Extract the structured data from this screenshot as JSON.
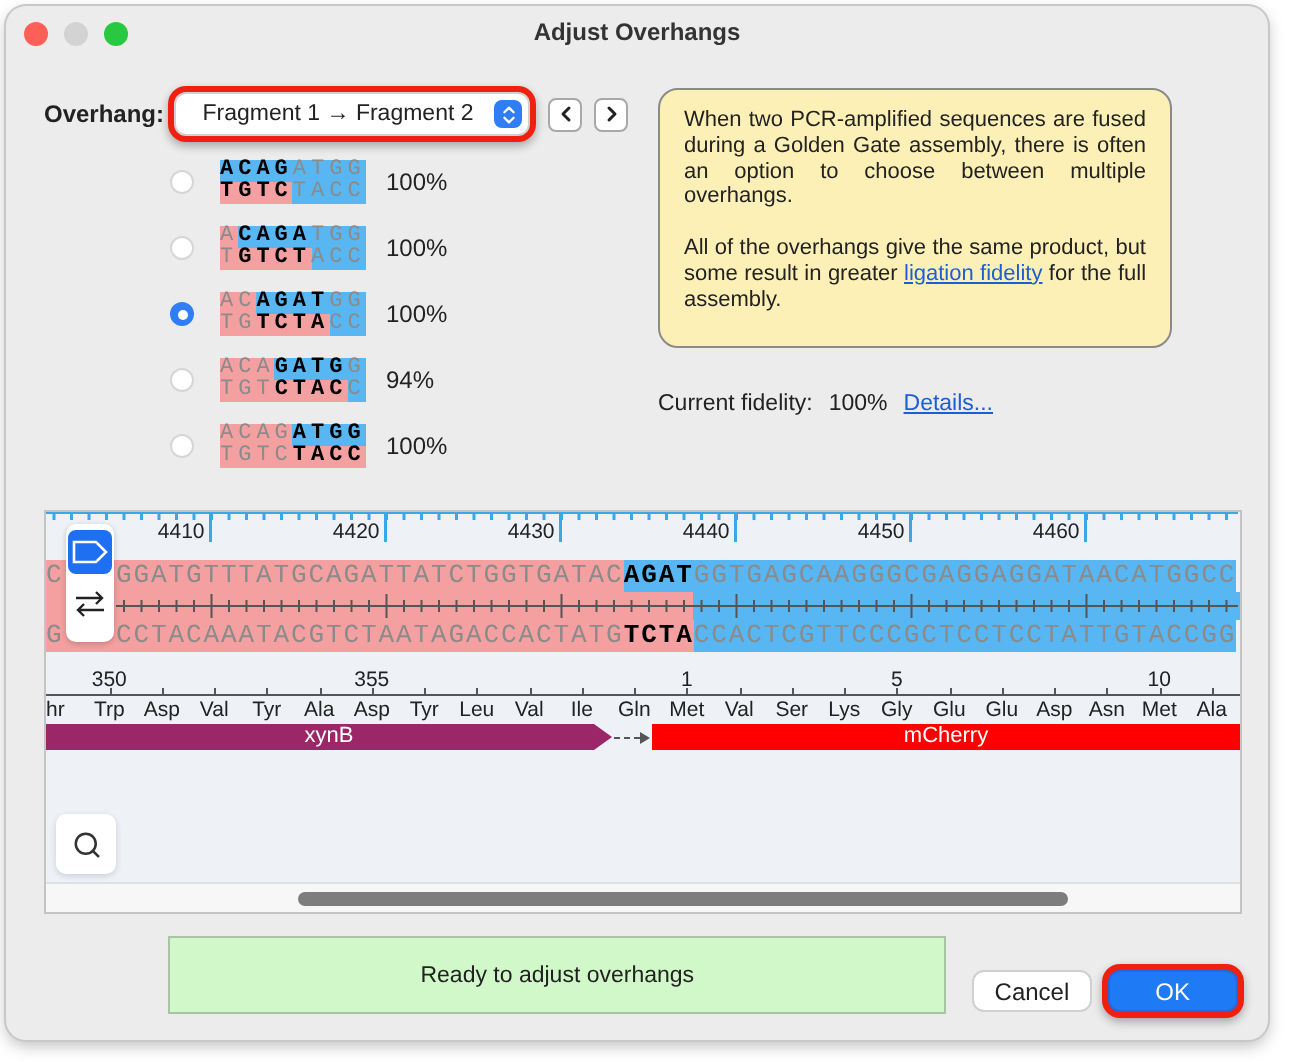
{
  "window": {
    "title": "Adjust Overhangs"
  },
  "overhang": {
    "label": "Overhang:",
    "value": "Fragment 1 → Fragment 2",
    "highlighted": true
  },
  "options": [
    {
      "selected": false,
      "fidelity": "100%",
      "top": [
        {
          "text": "ACAG",
          "bold": true,
          "color": "#58b6f2"
        },
        {
          "text": "ATGG",
          "bold": false,
          "color": "#58b6f2"
        }
      ],
      "bottom": [
        {
          "text": "TGTC",
          "bold": true,
          "color": "#f5a0a0"
        },
        {
          "text": "TACC",
          "bold": false,
          "color": "#58b6f2"
        }
      ]
    },
    {
      "selected": false,
      "fidelity": "100%",
      "top": [
        {
          "text": "A",
          "bold": false,
          "color": "#f5a0a0"
        },
        {
          "text": "CAGA",
          "bold": true,
          "color": "#58b6f2"
        },
        {
          "text": "TGG",
          "bold": false,
          "color": "#58b6f2"
        }
      ],
      "bottom": [
        {
          "text": "T",
          "bold": false,
          "color": "#f5a0a0"
        },
        {
          "text": "GTCT",
          "bold": true,
          "color": "#f5a0a0"
        },
        {
          "text": "ACC",
          "bold": false,
          "color": "#58b6f2"
        }
      ]
    },
    {
      "selected": true,
      "fidelity": "100%",
      "top": [
        {
          "text": "AC",
          "bold": false,
          "color": "#f5a0a0"
        },
        {
          "text": "AGAT",
          "bold": true,
          "color": "#58b6f2"
        },
        {
          "text": "GG",
          "bold": false,
          "color": "#58b6f2"
        }
      ],
      "bottom": [
        {
          "text": "TG",
          "bold": false,
          "color": "#f5a0a0"
        },
        {
          "text": "TCTA",
          "bold": true,
          "color": "#f5a0a0"
        },
        {
          "text": "CC",
          "bold": false,
          "color": "#58b6f2"
        }
      ]
    },
    {
      "selected": false,
      "fidelity": "94%",
      "top": [
        {
          "text": "ACA",
          "bold": false,
          "color": "#f5a0a0"
        },
        {
          "text": "GATG",
          "bold": true,
          "color": "#58b6f2"
        },
        {
          "text": "G",
          "bold": false,
          "color": "#58b6f2"
        }
      ],
      "bottom": [
        {
          "text": "TGT",
          "bold": false,
          "color": "#f5a0a0"
        },
        {
          "text": "CTAC",
          "bold": true,
          "color": "#f5a0a0"
        },
        {
          "text": "C",
          "bold": false,
          "color": "#58b6f2"
        }
      ]
    },
    {
      "selected": false,
      "fidelity": "100%",
      "top": [
        {
          "text": "ACAG",
          "bold": false,
          "color": "#f5a0a0"
        },
        {
          "text": "ATGG",
          "bold": true,
          "color": "#58b6f2"
        }
      ],
      "bottom": [
        {
          "text": "TGTC",
          "bold": false,
          "color": "#f5a0a0"
        },
        {
          "text": "TACC",
          "bold": true,
          "color": "#f5a0a0"
        }
      ]
    }
  ],
  "info": {
    "paragraph_1": "When two PCR-amplified sequences are fused during a Golden Gate assembly, there is often an option to choose between multiple overhangs.",
    "paragraph_2_before": "All of the overhangs give the same product, but some result in greater ",
    "paragraph_2_link": "ligation fidelity",
    "paragraph_2_after": " for the full assembly."
  },
  "fidelity": {
    "label": "Current fidelity:",
    "value": "100%",
    "link": "Details..."
  },
  "sequence": {
    "ruler": [
      "4410",
      "4420",
      "4430",
      "4440",
      "4450",
      "4460"
    ],
    "top": [
      {
        "text": "C",
        "bold": false,
        "color": "#f5a0a0"
      },
      {
        "text": "GGATGTTTATGCAGATTATCTGGTGATAC",
        "bold": false,
        "color": "#f5a0a0"
      },
      {
        "text": "AGAT",
        "bold": true,
        "color": "#58b6f2"
      },
      {
        "text": "GGTGAGCAAGGGCGAGGAGGATAACATGGCC",
        "bold": false,
        "color": "#58b6f2"
      }
    ],
    "bottom": [
      {
        "text": "G",
        "bold": false,
        "color": "#f5a0a0"
      },
      {
        "text": "CCTACAAATACGTCTAATAGACCACTATG",
        "bold": false,
        "color": "#f5a0a0"
      },
      {
        "text": "TCTA",
        "bold": true,
        "color": "#f5a0a0"
      },
      {
        "text": "CCACTCGTTCCCGCTCCTCCTATTGTACCGG",
        "bold": false,
        "color": "#58b6f2"
      }
    ],
    "residues": [
      {
        "name": "hr"
      },
      {
        "name": "Trp",
        "number": "350"
      },
      {
        "name": "Asp"
      },
      {
        "name": "Val"
      },
      {
        "name": "Tyr"
      },
      {
        "name": "Ala"
      },
      {
        "name": "Asp",
        "number": "355"
      },
      {
        "name": "Tyr"
      },
      {
        "name": "Leu"
      },
      {
        "name": "Val"
      },
      {
        "name": "Ile"
      },
      {
        "name": "Gln"
      },
      {
        "name": "Met",
        "number": "1"
      },
      {
        "name": "Val"
      },
      {
        "name": "Ser"
      },
      {
        "name": "Lys"
      },
      {
        "name": "Gly",
        "number": "5"
      },
      {
        "name": "Glu"
      },
      {
        "name": "Glu"
      },
      {
        "name": "Asp"
      },
      {
        "name": "Asn"
      },
      {
        "name": "Met",
        "number": "10"
      },
      {
        "name": "Ala"
      }
    ],
    "features": [
      {
        "name": "xynB",
        "kind": "arrow",
        "color": "#9b2768"
      },
      {
        "name": "mCherry",
        "kind": "bar",
        "color": "#ff0000"
      }
    ]
  },
  "status": "Ready to adjust overhangs",
  "buttons": [
    {
      "label": "Cancel",
      "kind": "secondary",
      "highlighted": false
    },
    {
      "label": "OK",
      "kind": "primary",
      "highlighted": true
    }
  ]
}
